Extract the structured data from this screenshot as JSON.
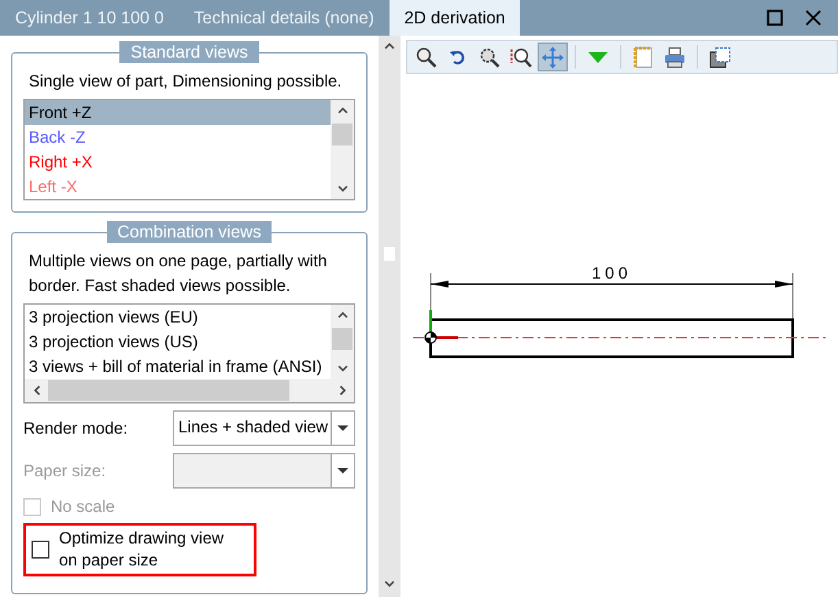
{
  "tabs": [
    {
      "label": "Cylinder 1 10 100 0",
      "selected": false
    },
    {
      "label": "Technical details (none)",
      "selected": false
    },
    {
      "label": "2D derivation",
      "selected": true
    }
  ],
  "standard_views": {
    "title": "Standard views",
    "description": "Single view of part, Dimensioning possible.",
    "items": [
      {
        "label": "Front +Z",
        "color": "#000000",
        "selected": true
      },
      {
        "label": "Back -Z",
        "color": "#5a5aff",
        "selected": false
      },
      {
        "label": "Right +X",
        "color": "#ff0000",
        "selected": false
      },
      {
        "label": "Left -X",
        "color": "#ff6a6a",
        "selected": false
      }
    ]
  },
  "combination_views": {
    "title": "Combination views",
    "description": "Multiple views on one page, partially with border. Fast shaded views possible.",
    "items": [
      {
        "label": "3 projection views (EU)",
        "selected": false
      },
      {
        "label": "3 projection views (US)",
        "selected": false
      },
      {
        "label": "3 views + bill of material in frame (ANSI)",
        "selected": false
      }
    ],
    "render_mode": {
      "label": "Render mode:",
      "value": "Lines + shaded view",
      "disabled": false
    },
    "paper_size": {
      "label": "Paper size:",
      "disabled": true
    },
    "no_scale": {
      "label": "No scale",
      "checked": false,
      "disabled": true
    },
    "optimize": {
      "label": "Optimize drawing view on paper size",
      "checked": false,
      "highlighted": true
    }
  },
  "toolbar": [
    {
      "kind": "zoom",
      "selected": false
    },
    {
      "kind": "undo",
      "selected": false
    },
    {
      "kind": "zoom-window",
      "selected": false
    },
    {
      "kind": "zoom-fit",
      "selected": false
    },
    {
      "kind": "move",
      "selected": true
    },
    {
      "kind": "separator"
    },
    {
      "kind": "dropdown",
      "selected": false
    },
    {
      "kind": "separator"
    },
    {
      "kind": "frame",
      "selected": false
    },
    {
      "kind": "print",
      "selected": false
    },
    {
      "kind": "separator"
    },
    {
      "kind": "export",
      "selected": false
    }
  ],
  "drawing": {
    "dimension": "100"
  }
}
